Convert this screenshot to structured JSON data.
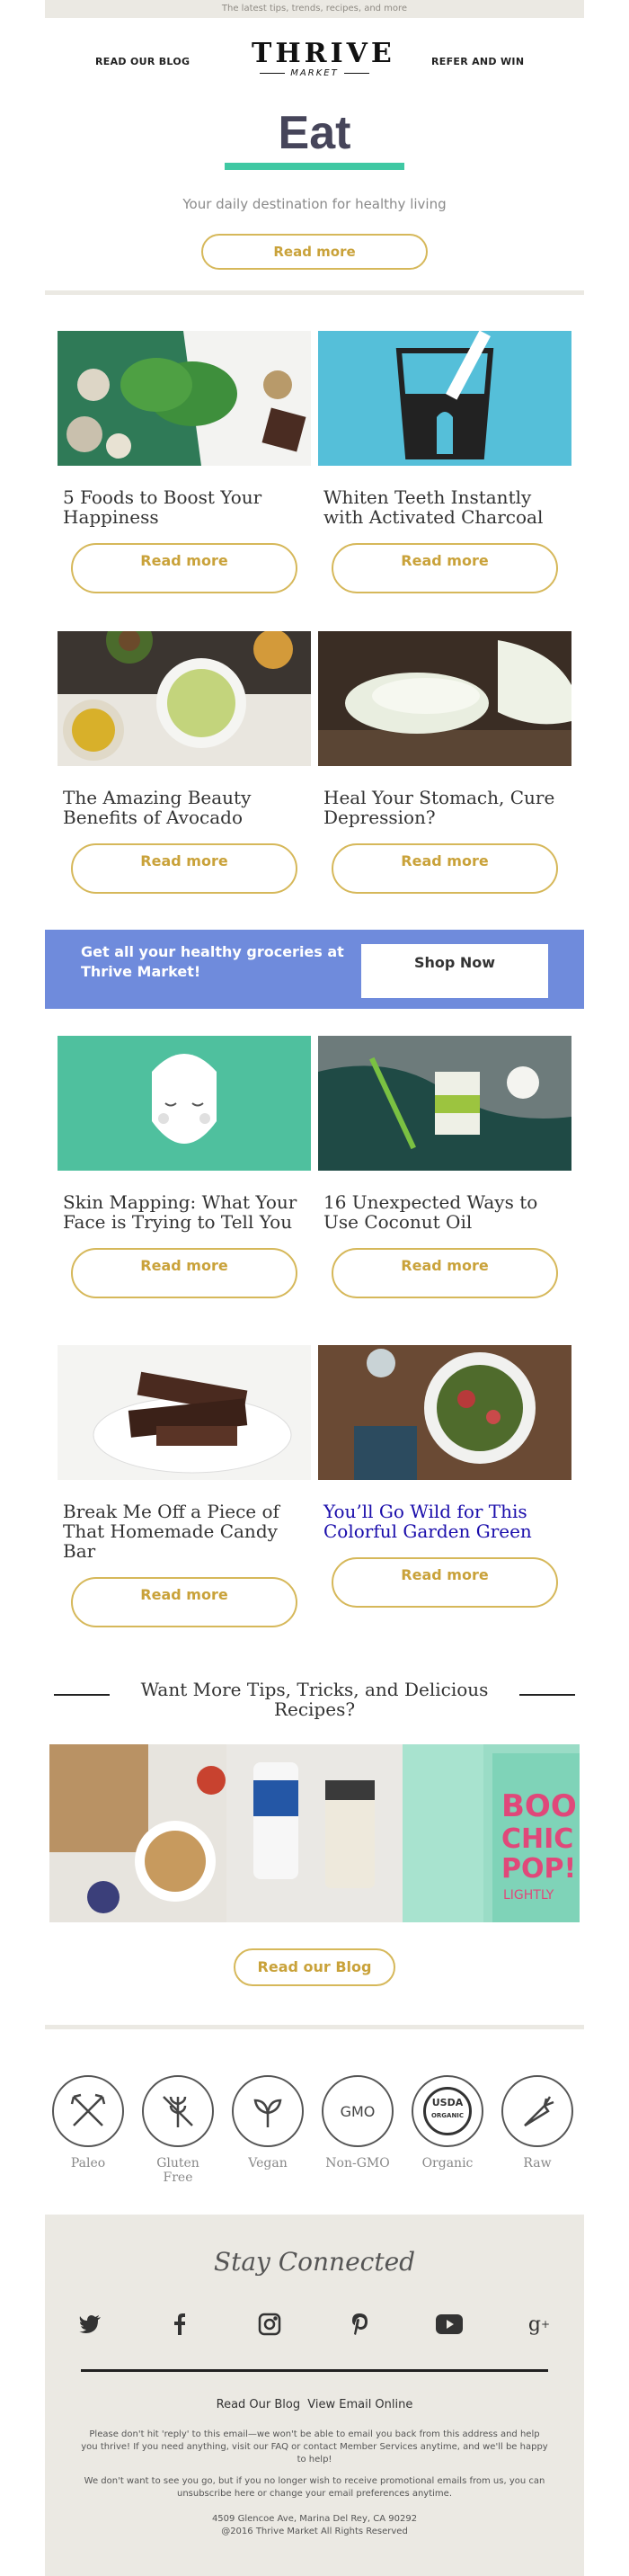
{
  "preheader": "The latest tips, trends, recipes, and more",
  "nav": {
    "left": "READ OUR BLOG",
    "right": "REFER AND WIN",
    "logo_main": "THRIVE",
    "logo_sub": "MARKET"
  },
  "hero": {
    "title": "Eat",
    "subtitle": "Your daily destination for healthy living",
    "button": "Read more"
  },
  "articles": [
    {
      "title": "5 Foods to Boost Your Happiness",
      "button": "Read more"
    },
    {
      "title": "Whiten Teeth Instantly with Activated Charcoal",
      "button": "Read more"
    },
    {
      "title": "The Amazing Beauty Benefits of Avocado",
      "button": "Read more"
    },
    {
      "title": "Heal Your Stomach, Cure Depression?",
      "button": "Read more"
    },
    {
      "title": "Skin Mapping: What Your Face is Trying to Tell You",
      "button": "Read more"
    },
    {
      "title": "16 Unexpected Ways to Use Coconut Oil",
      "button": "Read more"
    },
    {
      "title": "Break Me Off a Piece of That Homemade Candy Bar",
      "button": "Read more"
    },
    {
      "title": "You’ll Go Wild for This Colorful Garden Green",
      "button": "Read more"
    }
  ],
  "promo": {
    "text": "Get all your healthy groceries at Thrive Market!",
    "button": "Shop Now"
  },
  "more": {
    "heading": "Want More Tips, Tricks, and Delicious Recipes?",
    "button": "Read our Blog"
  },
  "badges": [
    "Paleo",
    "Gluten Free",
    "Vegan",
    "Non-GMO",
    "Organic",
    "Raw"
  ],
  "badge_icons": {
    "gmo_text": "GMO",
    "usda_top": "USDA",
    "usda_bottom": "ORGANIC"
  },
  "collage_text": {
    "cell3_a": "BOO",
    "cell3_b": "CHIC",
    "cell3_c": "POP!",
    "cell3_d": "LIGHTLY"
  },
  "footer": {
    "title": "Stay Connected",
    "social": [
      "twitter-icon",
      "facebook-icon",
      "instagram-icon",
      "pinterest-icon",
      "youtube-icon",
      "google-plus-icon"
    ],
    "link_blog": "Read Our Blog",
    "link_online": "View Email Online",
    "notice1": "Please don't hit 'reply' to this email—we won't be able to email you back from this address and help you thrive! If you need anything, visit our FAQ or contact Member Services anytime, and we'll be happy to help!",
    "notice2": "We don't want to see you go, but if you no longer wish to receive promotional emails from us, you can unsubscribe here or change your email preferences anytime.",
    "address": "4509 Glencoe Ave, Marina Del Rey, CA 90292",
    "copyright": "@2016 Thrive Market All Rights Reserved"
  },
  "colors": {
    "accent_green": "#3fc8a3",
    "button_gold": "#d6b85a",
    "promo_blue": "#6f8bdc",
    "footer_bg": "#ebe9e3"
  }
}
